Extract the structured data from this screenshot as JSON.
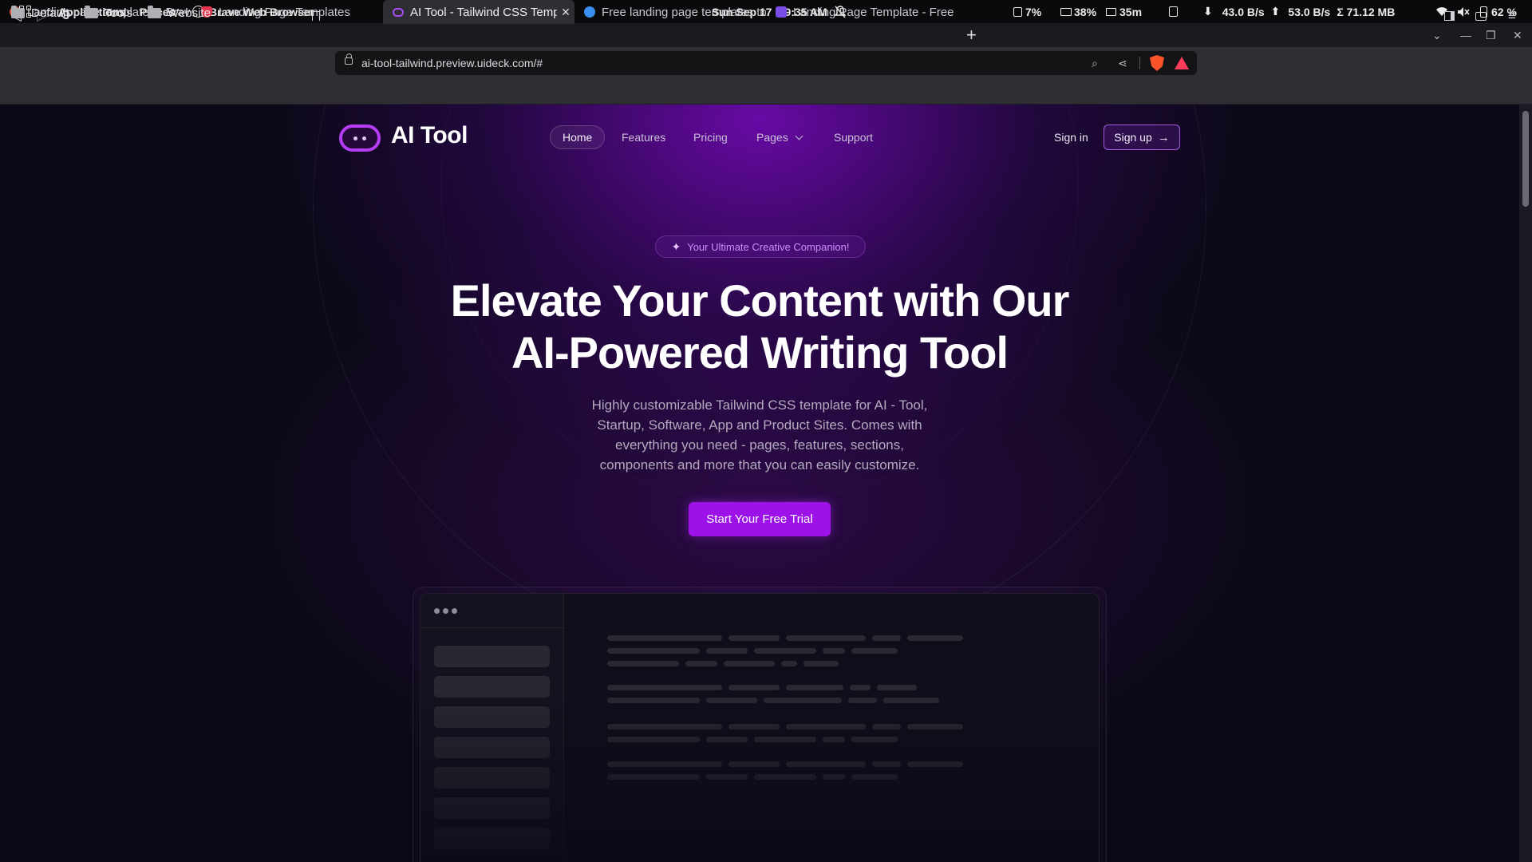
{
  "os_bar": {
    "applications": "Applications",
    "places": "Places",
    "app_name": "Brave Web Browser",
    "date": "Sun Sep 17",
    "time": "9:35 AM",
    "cpu": "7%",
    "mem": "38%",
    "uptime": "35m",
    "down_speed": "43.0 B/s",
    "up_speed": "53.0 B/s",
    "total": "Σ 71.12 MB",
    "battery": "62 %"
  },
  "tabs": [
    {
      "title": "Landing page templates - Brave",
      "favicon_color": "#e0533a",
      "active": false
    },
    {
      "title": "Landing Page Templates",
      "favicon_color": "#e8364f",
      "active": false
    },
    {
      "title": "AI Tool - Tailwind CSS Template",
      "favicon_color": "#a64df0",
      "active": true
    },
    {
      "title": "Free landing page templates to",
      "favicon_color": "#3a8ef0",
      "active": false
    },
    {
      "title": "Landing Page Template - Free",
      "favicon_color": "#7b4de8",
      "active": false
    }
  ],
  "address_bar": {
    "url": "ai-tool-tailwind.preview.uideck.com/#"
  },
  "bookmarks": [
    "Default",
    "Tools",
    "Website"
  ],
  "site": {
    "logo": "AI Tool",
    "nav": [
      "Home",
      "Features",
      "Pricing",
      "Pages",
      "Support"
    ],
    "sign_in": "Sign in",
    "sign_up": "Sign up",
    "badge": "Your Ultimate Creative Companion!",
    "title_line1": "Elevate Your Content with Our",
    "title_line2": "AI-Powered Writing Tool",
    "subtitle": "Highly customizable Tailwind CSS template for AI - Tool, Startup, Software, App and Product Sites. Comes with everything you need - pages, features, sections, components and more that you can easily customize.",
    "cta": "Start Your Free Trial"
  },
  "colors": {
    "accent": "#9d12e8",
    "brand_purple": "#b73cf5",
    "badge_text": "#d08cff",
    "background": "#0b0916"
  }
}
